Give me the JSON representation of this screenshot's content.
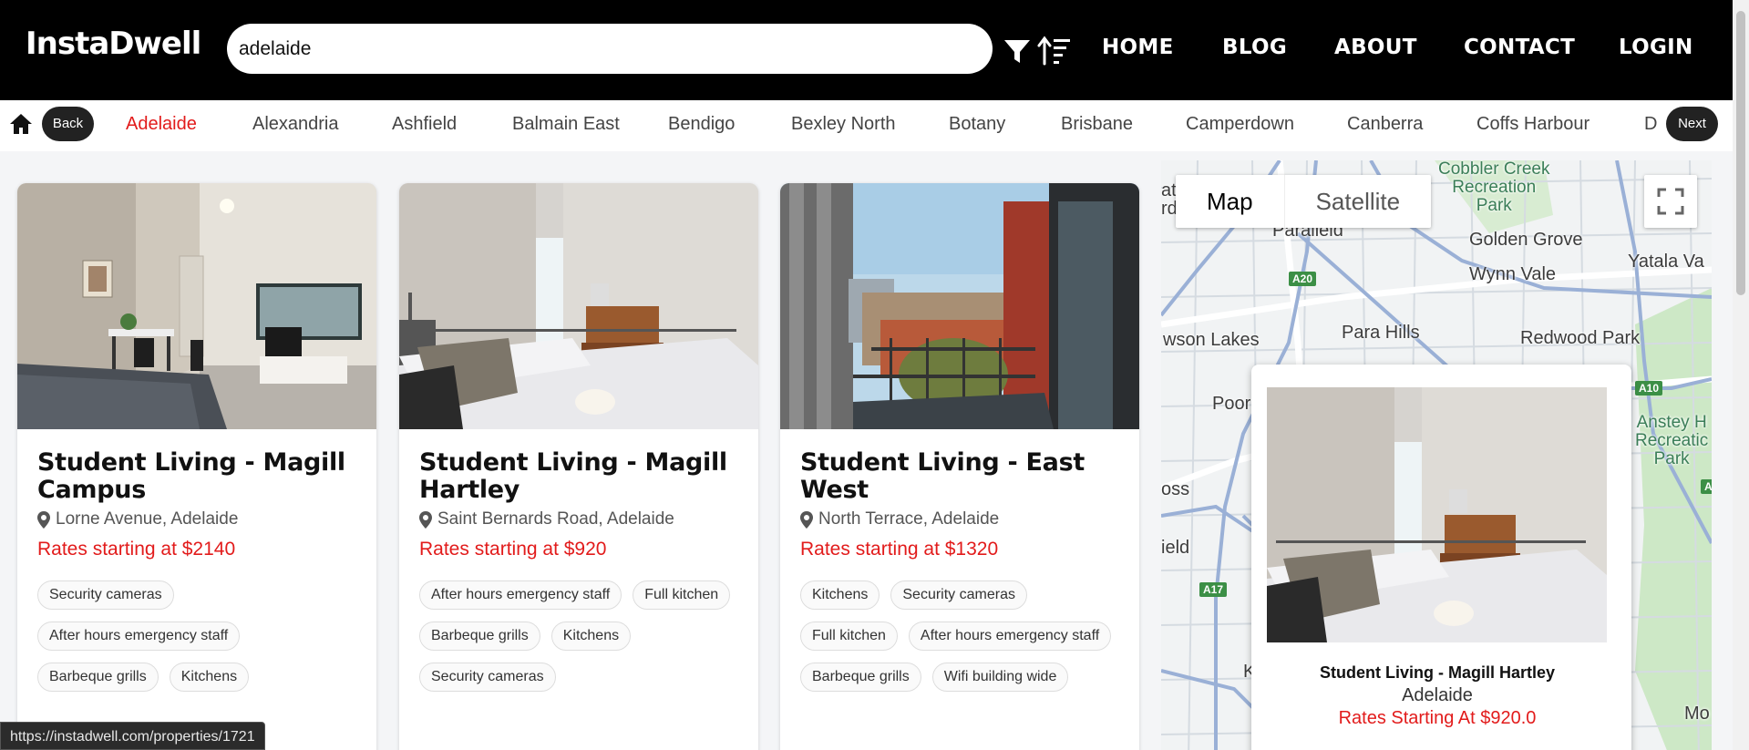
{
  "header": {
    "logo": "InstaDwell",
    "search_value": "adelaide",
    "nav": [
      "HOME",
      "BLOG",
      "ABOUT",
      "CONTACT",
      "LOGIN"
    ]
  },
  "citybar": {
    "back_label": "Back",
    "next_label": "Next",
    "cities": [
      "Adelaide",
      "Alexandria",
      "Ashfield",
      "Balmain East",
      "Bendigo",
      "Bexley North",
      "Botany",
      "Brisbane",
      "Camperdown",
      "Canberra",
      "Coffs Harbour",
      "D"
    ],
    "active_city": "Adelaide"
  },
  "listings": [
    {
      "title": "Student Living - Magill Campus",
      "address": "Lorne Avenue, Adelaide",
      "rate": "Rates starting at $2140",
      "tags": [
        "Security cameras",
        "After hours emergency staff",
        "Barbeque grills",
        "Kitchens"
      ]
    },
    {
      "title": "Student Living - Magill Hartley",
      "address": "Saint Bernards Road, Adelaide",
      "rate": "Rates starting at $920",
      "tags": [
        "After hours emergency staff",
        "Full kitchen",
        "Barbeque grills",
        "Kitchens",
        "Security cameras"
      ]
    },
    {
      "title": "Student Living - East West",
      "address": "North Terrace, Adelaide",
      "rate": "Rates starting at $1320",
      "tags": [
        "Kitchens",
        "Security cameras",
        "Full kitchen",
        "After hours emergency staff",
        "Barbeque grills",
        "Wifi building wide"
      ]
    }
  ],
  "map": {
    "type_map": "Map",
    "type_satellite": "Satellite",
    "labels": [
      "Golden Grove",
      "Wynn Vale",
      "Yatala Va",
      "Para Hills",
      "Redwood Park",
      "Paralield",
      "wson Lakes",
      "Poor",
      "oss",
      "ield",
      "Mo",
      "K",
      "at",
      "rd"
    ],
    "park_labels": [
      "Cobbler Creek\nRecreation\nPark",
      "Anstey H\nRecreatic\nPark"
    ],
    "shields": [
      "A20",
      "A10",
      "A17",
      "A"
    ],
    "popup": {
      "title": "Student Living - Magill Hartley",
      "city": "Adelaide",
      "rate": "Rates Starting At $920.0"
    }
  },
  "status_url": "https://instadwell.com/properties/1721"
}
